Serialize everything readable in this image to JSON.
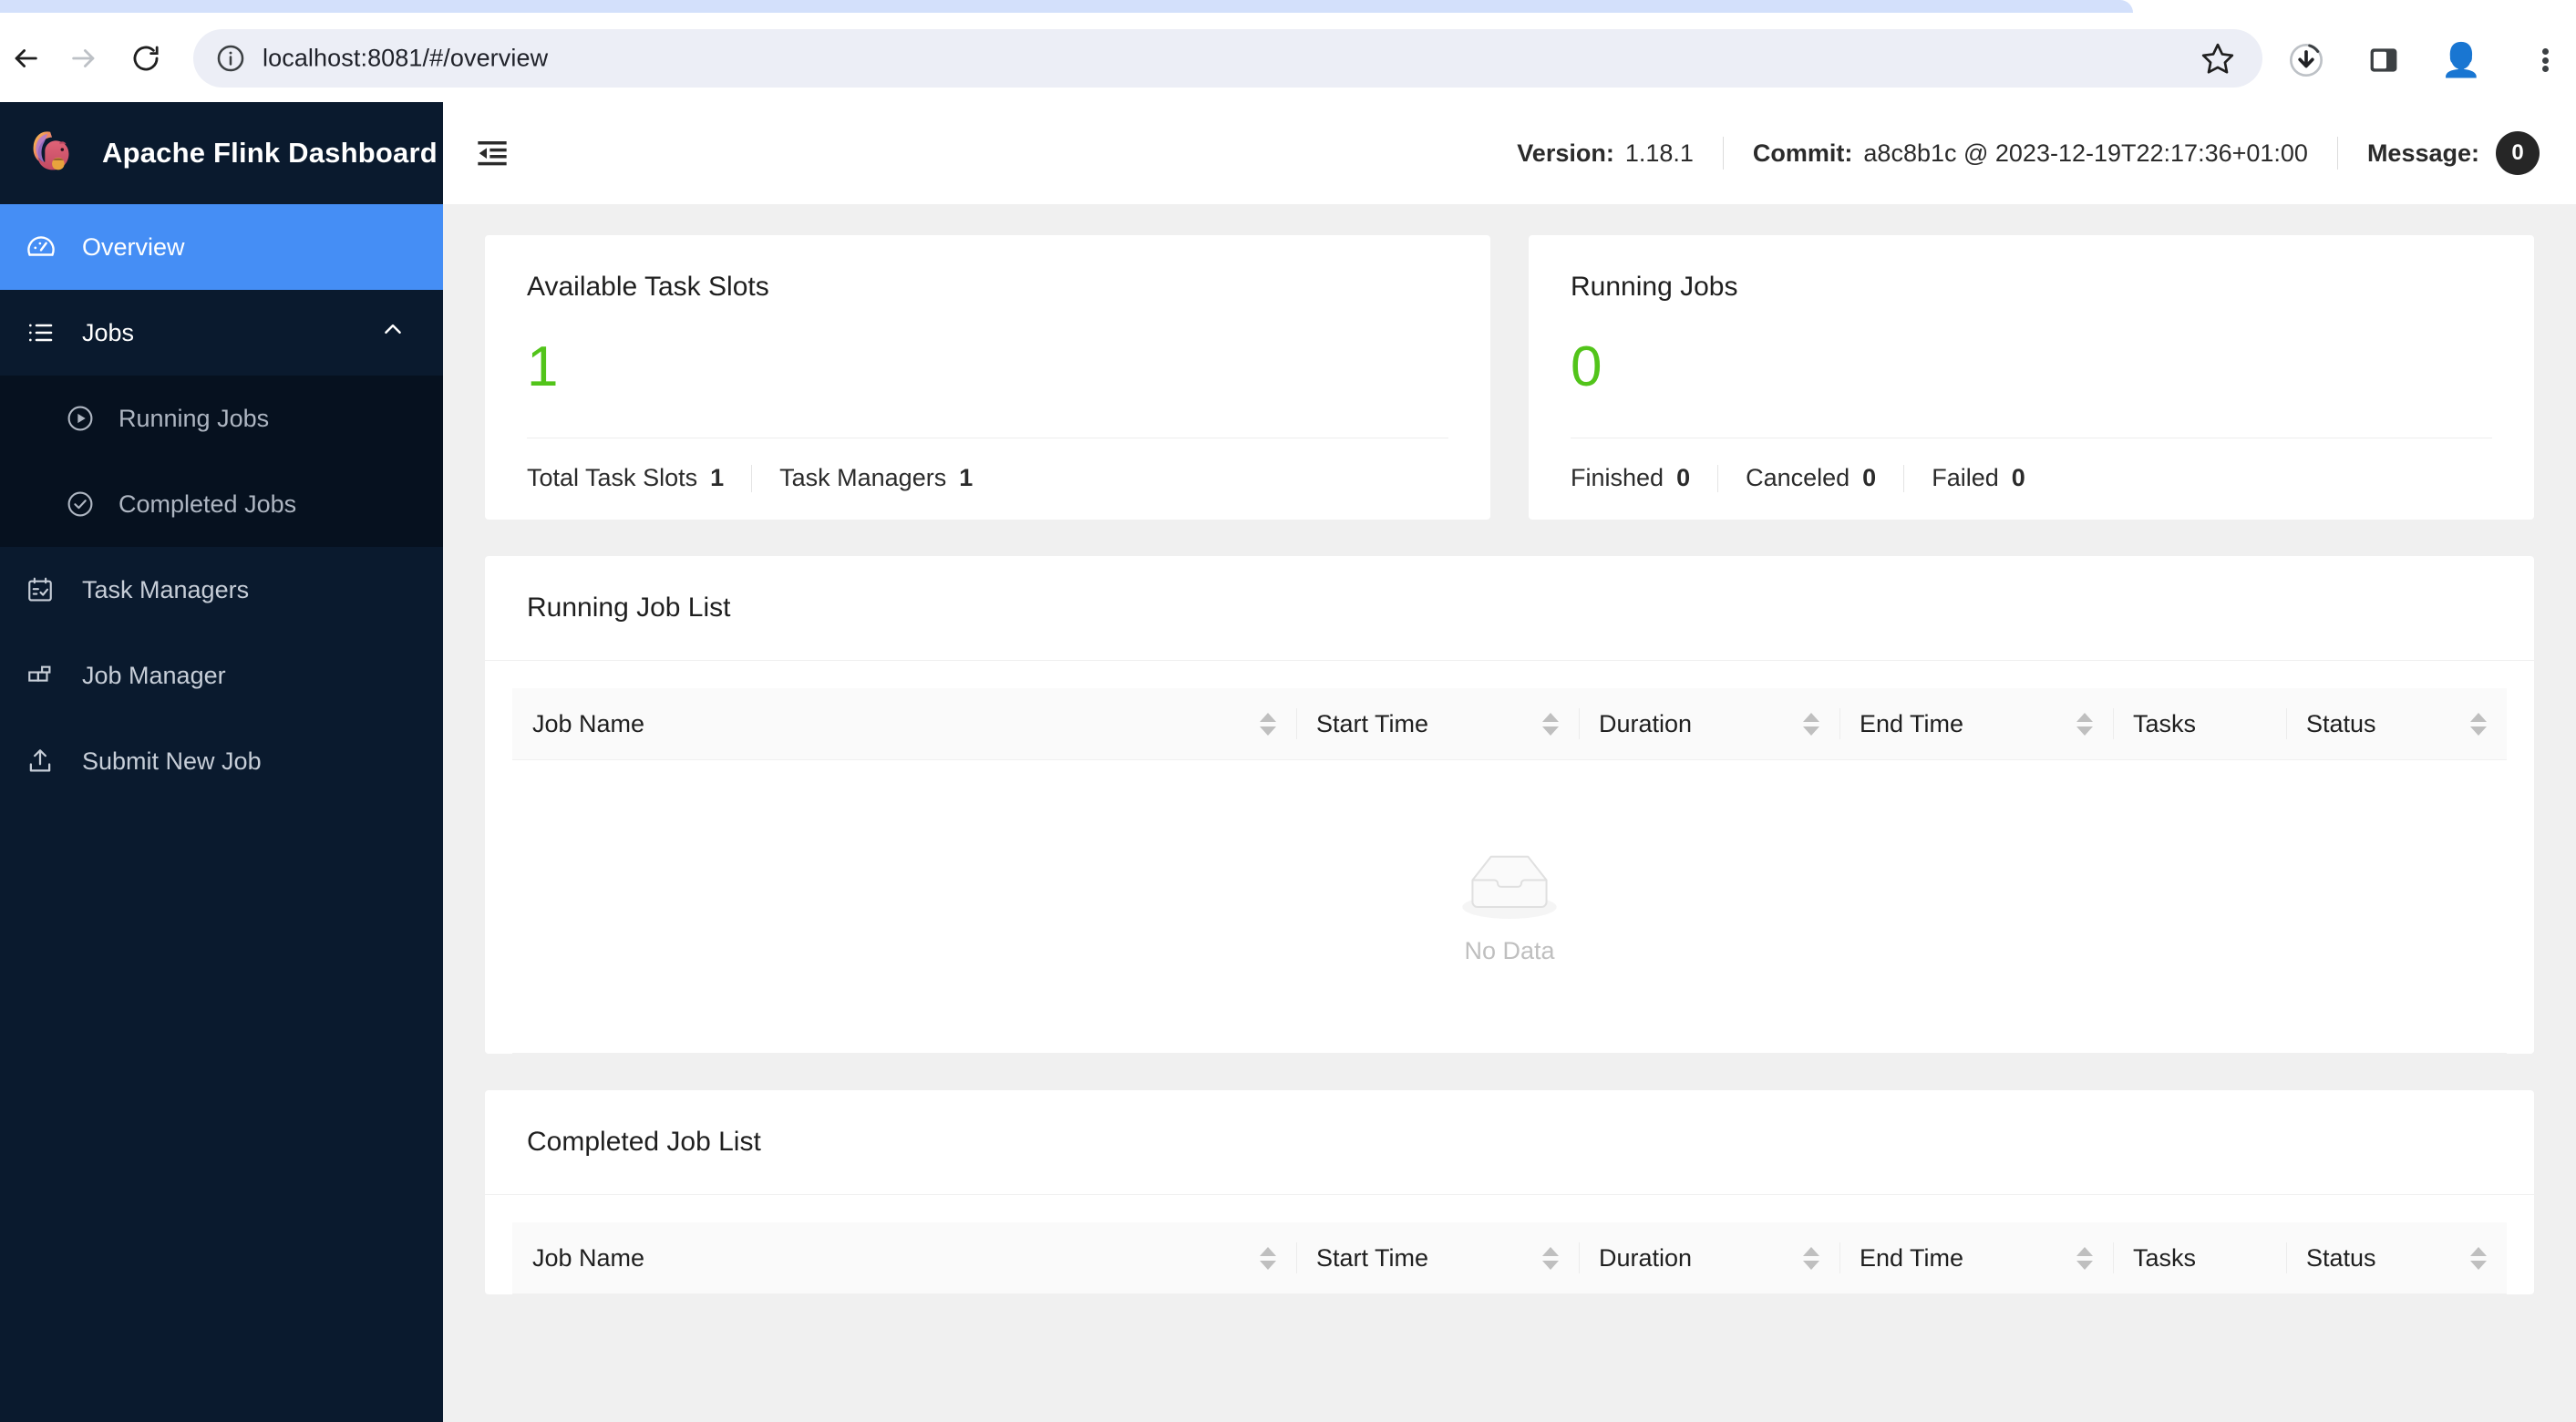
{
  "browser": {
    "url": "localhost:8081/#/overview",
    "back_label": "Back",
    "forward_label": "Forward",
    "reload_label": "Reload",
    "site_info_icon": "info-circle-icon",
    "bookmark_icon": "star-icon",
    "download_icon": "download-icon",
    "sidepanel_icon": "side-panel-icon",
    "profile_icon": "avatar-icon",
    "menu_icon": "kebab-menu-icon"
  },
  "sidebar": {
    "brand": "Apache Flink Dashboard",
    "logo_icon": "flink-squirrel-logo",
    "items": [
      {
        "label": "Overview",
        "icon": "dashboard-gauge-icon",
        "active": true
      },
      {
        "label": "Jobs",
        "icon": "list-icon",
        "expanded": true,
        "chevron": "chevron-up-icon"
      },
      {
        "label": "Task Managers",
        "icon": "schedule-check-icon",
        "active": false
      },
      {
        "label": "Job Manager",
        "icon": "blocks-icon",
        "active": false
      },
      {
        "label": "Submit New Job",
        "icon": "upload-icon",
        "active": false
      }
    ],
    "submenu": [
      {
        "label": "Running Jobs",
        "icon": "play-circle-icon"
      },
      {
        "label": "Completed Jobs",
        "icon": "check-circle-icon"
      }
    ]
  },
  "topbar": {
    "collapse_icon": "menu-fold-icon",
    "version_label": "Version:",
    "version_value": "1.18.1",
    "commit_label": "Commit:",
    "commit_value": "a8c8b1c @ 2023-12-19T22:17:36+01:00",
    "message_label": "Message:",
    "message_count": "0"
  },
  "cards": {
    "task_slots": {
      "title": "Available Task Slots",
      "value": "1",
      "value_color": "#52c41a",
      "stats": [
        {
          "label": "Total Task Slots",
          "value": "1"
        },
        {
          "label": "Task Managers",
          "value": "1"
        }
      ]
    },
    "running_jobs": {
      "title": "Running Jobs",
      "value": "0",
      "value_color": "#52c41a",
      "stats": [
        {
          "label": "Finished",
          "value": "0"
        },
        {
          "label": "Canceled",
          "value": "0"
        },
        {
          "label": "Failed",
          "value": "0"
        }
      ]
    }
  },
  "running_job_list": {
    "title": "Running Job List",
    "columns": [
      {
        "label": "Job Name",
        "sortable": true
      },
      {
        "label": "Start Time",
        "sortable": true
      },
      {
        "label": "Duration",
        "sortable": true
      },
      {
        "label": "End Time",
        "sortable": true
      },
      {
        "label": "Tasks",
        "sortable": false
      },
      {
        "label": "Status",
        "sortable": true
      }
    ],
    "rows": [],
    "empty_text": "No Data",
    "empty_icon": "empty-box-icon"
  },
  "completed_job_list": {
    "title": "Completed Job List",
    "columns": [
      {
        "label": "Job Name",
        "sortable": true
      },
      {
        "label": "Start Time",
        "sortable": true
      },
      {
        "label": "Duration",
        "sortable": true
      },
      {
        "label": "End Time",
        "sortable": true
      },
      {
        "label": "Tasks",
        "sortable": false
      },
      {
        "label": "Status",
        "sortable": true
      }
    ],
    "rows": []
  },
  "theme": {
    "sidebar_bg": "#0a1a2e",
    "submenu_bg": "#06111f",
    "active_blue": "#458ef5",
    "green": "#52c41a",
    "content_bg": "#f0f0f0"
  }
}
